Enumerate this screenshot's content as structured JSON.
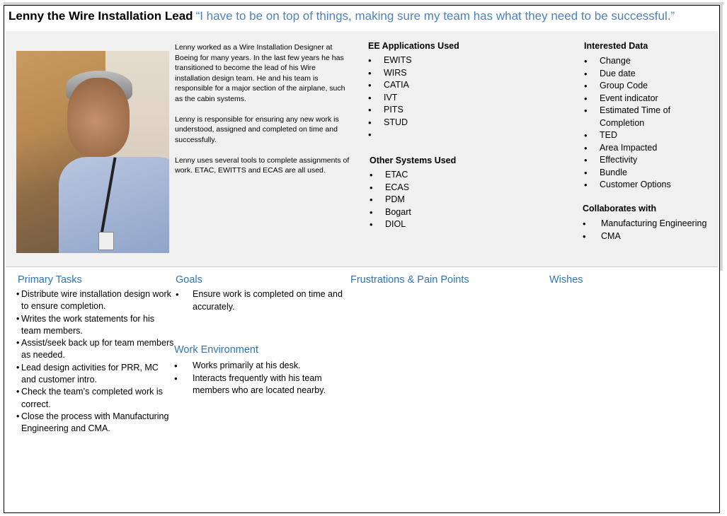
{
  "header": {
    "name": "Lenny the Wire Installation Lead",
    "quote": "“I have to be on top of things, making sure my team has what they need to be successful.”"
  },
  "bio": {
    "paragraphs": [
      "Lenny worked as a Wire Installation Designer at Boeing for many years.  In the last few years he has transitioned to become the lead of his Wire installation design team. He and his team is responsible for a major section of the airplane, such as the cabin systems.",
      "Lenny is responsible for ensuring any new work is understood, assigned and completed on time and successfully.",
      "Lenny uses several tools to complete assignments of work. ETAC, EWITTS and ECAS are all used."
    ]
  },
  "ee_apps": {
    "title": "EE Applications Used",
    "items": [
      "EWITS",
      "WIRS",
      "CATIA",
      "IVT",
      "PITS",
      "STUD",
      ""
    ]
  },
  "other_systems": {
    "title": "Other Systems Used",
    "items": [
      "ETAC",
      "ECAS",
      "PDM",
      "Bogart",
      "DIOL"
    ]
  },
  "interested_data": {
    "title": "Interested Data",
    "items": [
      "Change",
      "Due date",
      "Group Code",
      "Event indicator",
      "Estimated Time of Completion",
      "TED",
      "Area Impacted",
      "Effectivity",
      "Bundle",
      "Customer Options"
    ]
  },
  "collaborates": {
    "title": "Collaborates with",
    "items": [
      "Manufacturing Engineering",
      "CMA"
    ]
  },
  "primary_tasks": {
    "title": "Primary Tasks",
    "items": [
      "Distribute wire installation design work to ensure completion.",
      "Writes the work statements for his team members.",
      "Assist/seek back up for team members as needed.",
      "Lead design activities for PRR, MC and customer intro.",
      "Check the team’s completed work is correct.",
      "Close the process with Manufacturing Engineering and CMA."
    ]
  },
  "goals": {
    "title": "Goals",
    "items": [
      "Ensure work is completed on time and accurately."
    ]
  },
  "work_environment": {
    "title": "Work Environment",
    "items": [
      "Works primarily at his desk.",
      "Interacts frequently with his team members who are located nearby."
    ]
  },
  "frustrations": {
    "title": "Frustrations & Pain Points"
  },
  "wishes": {
    "title": "Wishes"
  }
}
